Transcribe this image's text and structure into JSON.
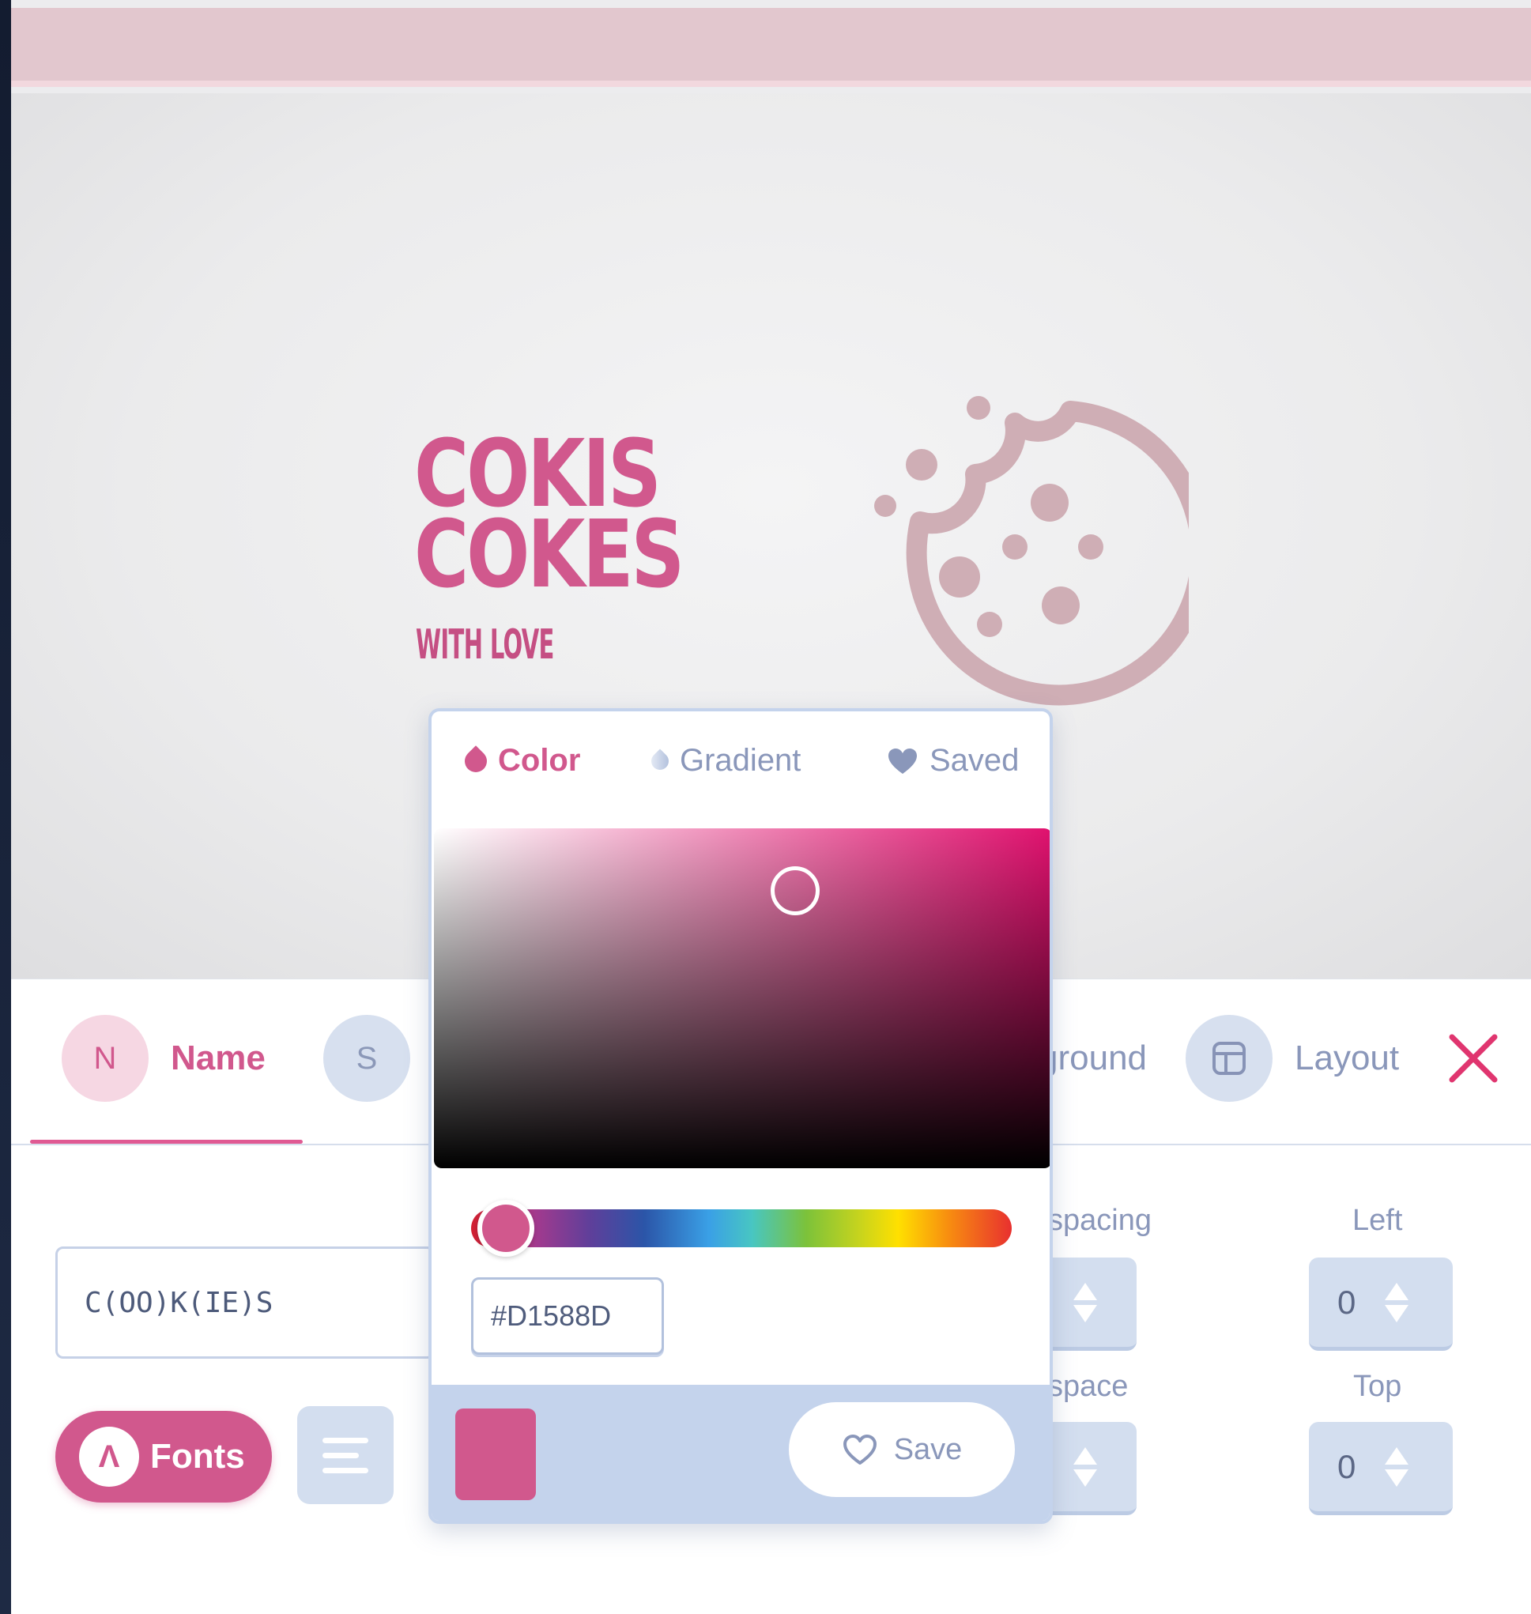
{
  "logo": {
    "line1": "COKIS",
    "line2": "COKES",
    "subtitle": "WITH LOVE"
  },
  "tabs": {
    "name_badge": "N",
    "name_label": "Name",
    "s_badge": "S",
    "background_label": "ground",
    "layout_label": "Layout"
  },
  "name_field": {
    "value": "C(OO)K(IE)S"
  },
  "fonts_button": {
    "icon": "Λ",
    "label": "Fonts"
  },
  "spacing": {
    "letter_spacing_label": "spacing",
    "line_space_label": "space",
    "left_label": "Left",
    "left_value": "0",
    "top_label": "Top",
    "top_value": "0"
  },
  "picker": {
    "tab_color": "Color",
    "tab_gradient": "Gradient",
    "tab_saved": "Saved",
    "hex_value": "#D1588D",
    "save_label": "Save"
  },
  "colors": {
    "accent": "#d1588d",
    "selected": "#d1588d",
    "muted": "#8a97ba"
  }
}
